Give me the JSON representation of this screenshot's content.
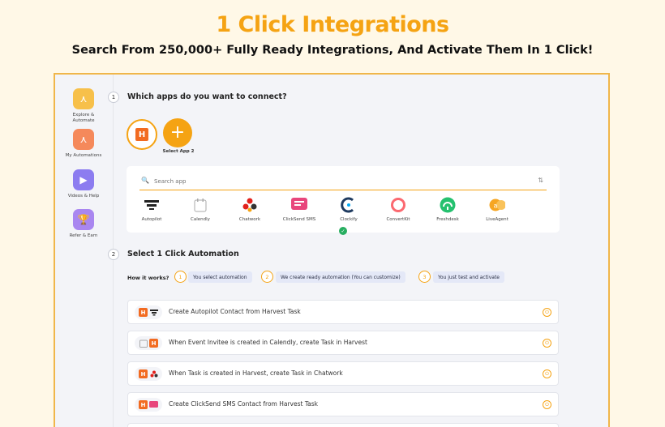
{
  "hero": {
    "title": "1 Click Integrations",
    "subtitle": "Search From 250,000+ Fully Ready Integrations, And Activate Them In 1 Click!"
  },
  "sidebar": {
    "items": [
      {
        "label": "Explore & Automate",
        "icon": "explore-icon",
        "color": "#F7C04A"
      },
      {
        "label": "My Automations",
        "icon": "automations-icon",
        "color": "#F5895B"
      },
      {
        "label": "Videos & Help",
        "icon": "play-icon",
        "color": "#8C7CF0"
      },
      {
        "label": "Refer & Earn",
        "icon": "trophy-icon",
        "color": "#A986F0"
      }
    ]
  },
  "step1": {
    "number": "1",
    "title": "Which apps do you want to connect?",
    "add_label": "Select App 2"
  },
  "search": {
    "placeholder": "Search app"
  },
  "apps": [
    {
      "name": "Autopilot",
      "icon": "autopilot-icon"
    },
    {
      "name": "Calendly",
      "icon": "calendly-icon"
    },
    {
      "name": "Chatwork",
      "icon": "chatwork-icon"
    },
    {
      "name": "ClickSend SMS",
      "icon": "clicksend-icon"
    },
    {
      "name": "Clockify",
      "icon": "clockify-icon"
    },
    {
      "name": "ConvertKit",
      "icon": "convertkit-icon"
    },
    {
      "name": "Freshdesk",
      "icon": "freshdesk-icon"
    },
    {
      "name": "LiveAgent",
      "icon": "liveagent-icon"
    }
  ],
  "step2": {
    "number": "2",
    "title": "Select 1 Click Automation",
    "how_label": "How it works?",
    "steps": [
      {
        "num": "1",
        "text": "You select automation"
      },
      {
        "num": "2",
        "text": "We create ready automation (You can customize)"
      },
      {
        "num": "3",
        "text": "You just test and activate"
      }
    ]
  },
  "automations": [
    {
      "text": "Create Autopilot Contact from Harvest Task"
    },
    {
      "text": "When Event Invitee is created in Calendly, create Task in Harvest"
    },
    {
      "text": "When Task is created in Harvest, create Task in Chatwork"
    },
    {
      "text": "Create ClickSend SMS Contact from Harvest Task"
    }
  ],
  "colors": {
    "accent": "#F5A313",
    "harvest": "#F26B21"
  }
}
